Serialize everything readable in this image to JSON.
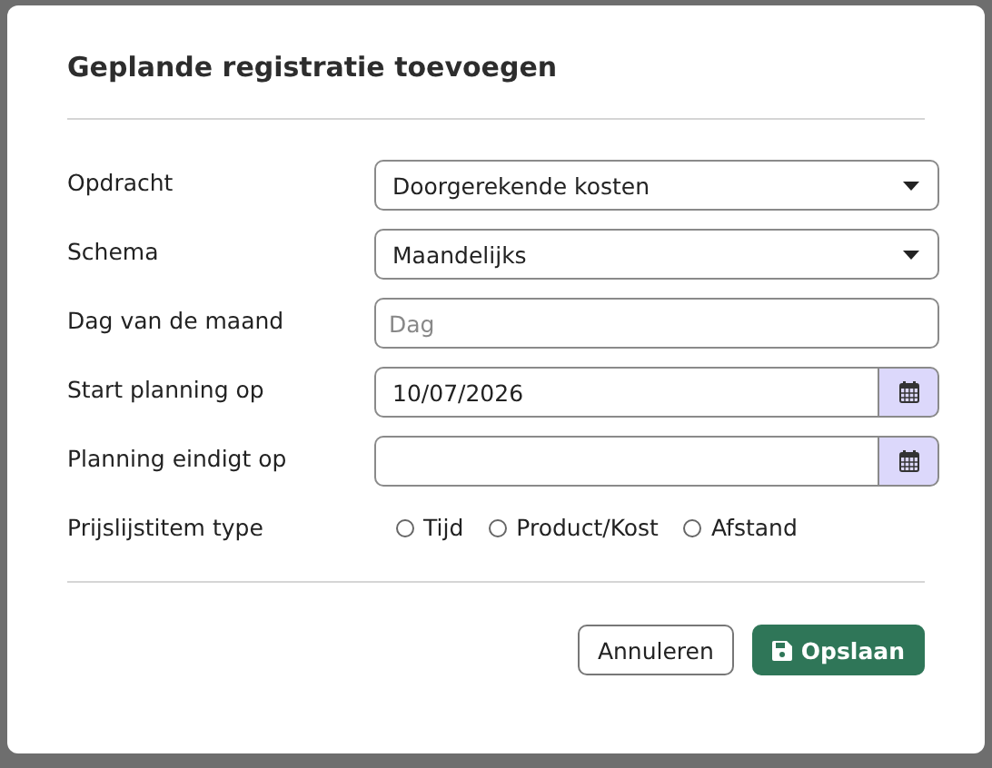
{
  "dialog": {
    "title": "Geplande registratie toevoegen",
    "fields": [
      {
        "kind": "select",
        "label": "Opdracht",
        "value": "Doorgerekende kosten"
      },
      {
        "kind": "select",
        "label": "Schema",
        "value": "Maandelijks"
      },
      {
        "kind": "text",
        "label": "Dag van de maand",
        "placeholder": "Dag"
      },
      {
        "kind": "date",
        "label": "Start planning op",
        "value": "10/07/2026"
      },
      {
        "kind": "date",
        "label": "Planning eindigt op"
      },
      {
        "kind": "radio",
        "label": "Prijslijstitem type",
        "options": [
          {
            "label": "Tijd",
            "selected": false
          },
          {
            "label": "Product/Kost",
            "selected": false
          },
          {
            "label": "Afstand",
            "selected": false
          }
        ]
      }
    ],
    "buttons": [
      {
        "kind": "secondary",
        "label": "Annuleren"
      },
      {
        "kind": "primary",
        "label": "Opslaan"
      }
    ]
  }
}
